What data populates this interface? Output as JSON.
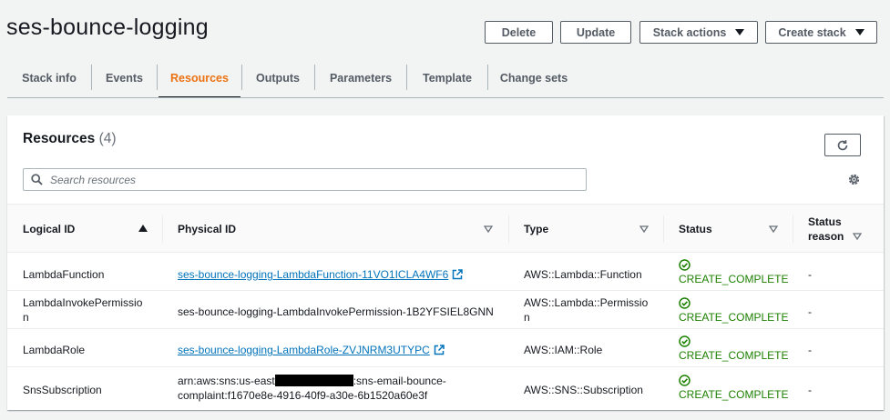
{
  "header": {
    "title": "ses-bounce-logging",
    "buttons": {
      "delete": "Delete",
      "update": "Update",
      "stack_actions": "Stack actions",
      "create_stack": "Create stack"
    }
  },
  "tabs": [
    {
      "label": "Stack info"
    },
    {
      "label": "Events"
    },
    {
      "label": "Resources",
      "active": true
    },
    {
      "label": "Outputs"
    },
    {
      "label": "Parameters"
    },
    {
      "label": "Template"
    },
    {
      "label": "Change sets"
    }
  ],
  "resources": {
    "title": "Resources",
    "count": "(4)",
    "search_placeholder": "Search resources",
    "columns": {
      "logical_id": "Logical ID",
      "physical_id": "Physical ID",
      "type": "Type",
      "status": "Status",
      "status_reason_1": "Status",
      "status_reason_2": "reason"
    },
    "rows": [
      {
        "logical_id": "LambdaFunction",
        "physical_id": "ses-bounce-logging-LambdaFunction-11VO1ICLA4WF6",
        "type": "AWS::Lambda::Function",
        "status": "CREATE_COMPLETE",
        "status_reason": "-"
      },
      {
        "logical_id_1": "LambdaInvokePermissio",
        "logical_id_2": "n",
        "physical_id": "ses-bounce-logging-LambdaInvokePermission-1B2YFSIEL8GNN",
        "type_1": "AWS::Lambda::Permissio",
        "type_2": "n",
        "status": "CREATE_COMPLETE",
        "status_reason": "-"
      },
      {
        "logical_id": "LambdaRole",
        "physical_id": "ses-bounce-logging-LambdaRole-ZVJNRM3UTYPC",
        "type": "AWS::IAM::Role",
        "status": "CREATE_COMPLETE",
        "status_reason": "-"
      },
      {
        "logical_id": "SnsSubscription",
        "physical_id_1a": "arn:aws:sns:us-east",
        "physical_id_1b": ":sns-email-bounce-",
        "physical_id_2": "complaint:f1670e8e-4916-40f9-a30e-6b1520a60e3f",
        "type": "AWS::SNS::Subscription",
        "status": "CREATE_COMPLETE",
        "status_reason": "-"
      }
    ]
  },
  "colors": {
    "accent": "#ec7211",
    "link": "#0073bb",
    "success": "#1d8102"
  }
}
